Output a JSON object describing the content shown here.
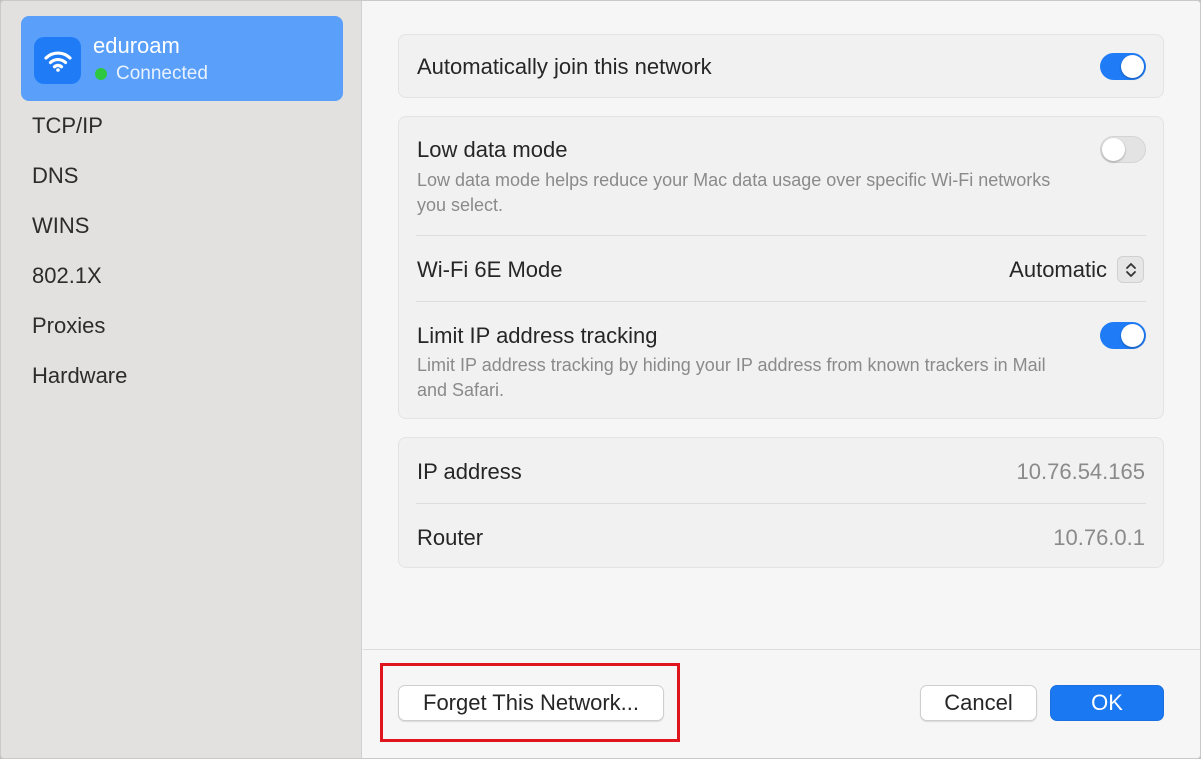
{
  "sidebar": {
    "selected_network": {
      "name": "eduroam",
      "status": "Connected",
      "icon": "wifi-icon",
      "status_color": "#2ec840"
    },
    "items": [
      {
        "label": "TCP/IP"
      },
      {
        "label": "DNS"
      },
      {
        "label": "WINS"
      },
      {
        "label": "802.1X"
      },
      {
        "label": "Proxies"
      },
      {
        "label": "Hardware"
      }
    ]
  },
  "main": {
    "auto_join": {
      "label": "Automatically join this network",
      "enabled": true
    },
    "low_data_mode": {
      "label": "Low data mode",
      "description": "Low data mode helps reduce your Mac data usage over specific Wi-Fi networks you select.",
      "enabled": false
    },
    "wifi6e": {
      "label": "Wi-Fi 6E Mode",
      "value": "Automatic",
      "icon": "chevron-up-down-icon"
    },
    "limit_ip": {
      "label": "Limit IP address tracking",
      "description": "Limit IP address tracking by hiding your IP address from known trackers in Mail and Safari.",
      "enabled": true
    },
    "ip_address": {
      "label": "IP address",
      "value": "10.76.54.165"
    },
    "router": {
      "label": "Router",
      "value": "10.76.0.1"
    }
  },
  "footer": {
    "forget_label": "Forget This Network...",
    "cancel_label": "Cancel",
    "ok_label": "OK"
  },
  "colors": {
    "accent": "#1f7cf6",
    "sidebar_selected": "#5aa0fb",
    "highlight": "#e0141c"
  }
}
